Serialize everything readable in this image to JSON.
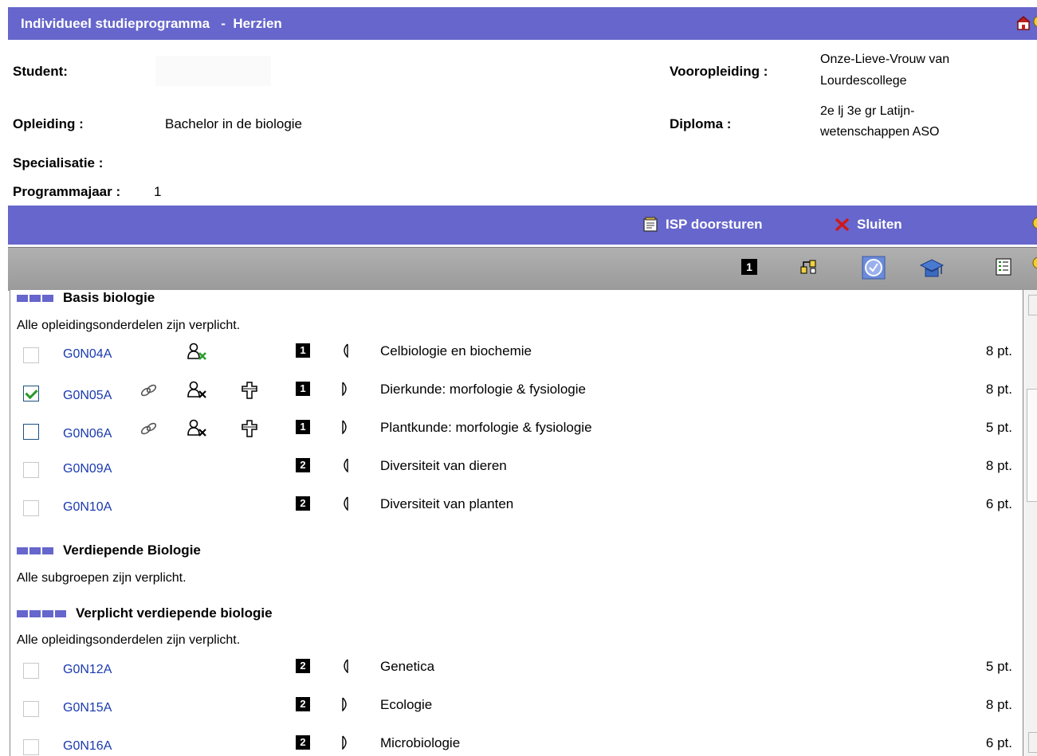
{
  "header": {
    "title": "Individueel studieprogramma   -  Herzien"
  },
  "info": {
    "student_label": "Student:",
    "opleiding_label": "Opleiding :",
    "opleiding_value": "Bachelor in de biologie",
    "specialisatie_label": "Specialisatie :",
    "programmajaar_label": "Programmajaar :",
    "programmajaar_value": "1",
    "vooropleiding_label": "Vooropleiding :",
    "vooropleiding_line1": "Onze-Lieve-Vrouw van",
    "vooropleiding_line2": "Lourdescollege",
    "diploma_label": "Diploma :",
    "diploma_line1": "2e lj 3e gr Latijn-",
    "diploma_line2": "wetenschappen ASO"
  },
  "actions": {
    "doorsturen_label": "ISP doorsturen",
    "sluiten_label": "Sluiten"
  },
  "toolbar": {
    "semester_badge": "1"
  },
  "groups": [
    {
      "title": "Basis biologie",
      "note": "Alle opleidingsonderdelen zijn verplicht."
    },
    {
      "title": "Verdiepende Biologie",
      "note": "Alle subgroepen zijn verplicht."
    },
    {
      "title": "Verplicht verdiepende biologie",
      "note": "Alle opleidingsonderdelen zijn verplicht."
    }
  ],
  "courses": [
    {
      "code": "G0N04A",
      "semester": "1",
      "half": "left",
      "name": "Celbiologie en biochemie",
      "points": "8 pt.",
      "checked": false,
      "enabled": false
    },
    {
      "code": "G0N05A",
      "semester": "1",
      "half": "right",
      "name": "Dierkunde: morfologie & fysiologie",
      "points": "8 pt.",
      "checked": true,
      "enabled": true
    },
    {
      "code": "G0N06A",
      "semester": "1",
      "half": "right",
      "name": "Plantkunde: morfologie & fysiologie",
      "points": "5 pt.",
      "checked": false,
      "enabled": true
    },
    {
      "code": "G0N09A",
      "semester": "2",
      "half": "left",
      "name": "Diversiteit van dieren",
      "points": "8 pt.",
      "checked": false,
      "enabled": false
    },
    {
      "code": "G0N10A",
      "semester": "2",
      "half": "left",
      "name": "Diversiteit van planten",
      "points": "6 pt.",
      "checked": false,
      "enabled": false
    },
    {
      "code": "G0N12A",
      "semester": "2",
      "half": "left",
      "name": "Genetica",
      "points": "5 pt.",
      "checked": false,
      "enabled": false
    },
    {
      "code": "G0N15A",
      "semester": "2",
      "half": "right",
      "name": "Ecologie",
      "points": "8 pt.",
      "checked": false,
      "enabled": false
    },
    {
      "code": "G0N16A",
      "semester": "2",
      "half": "right",
      "name": "Microbiologie",
      "points": "6 pt.",
      "checked": false,
      "enabled": false
    }
  ],
  "colors": {
    "bar": "#6666cc",
    "link": "#1a3ab0"
  }
}
